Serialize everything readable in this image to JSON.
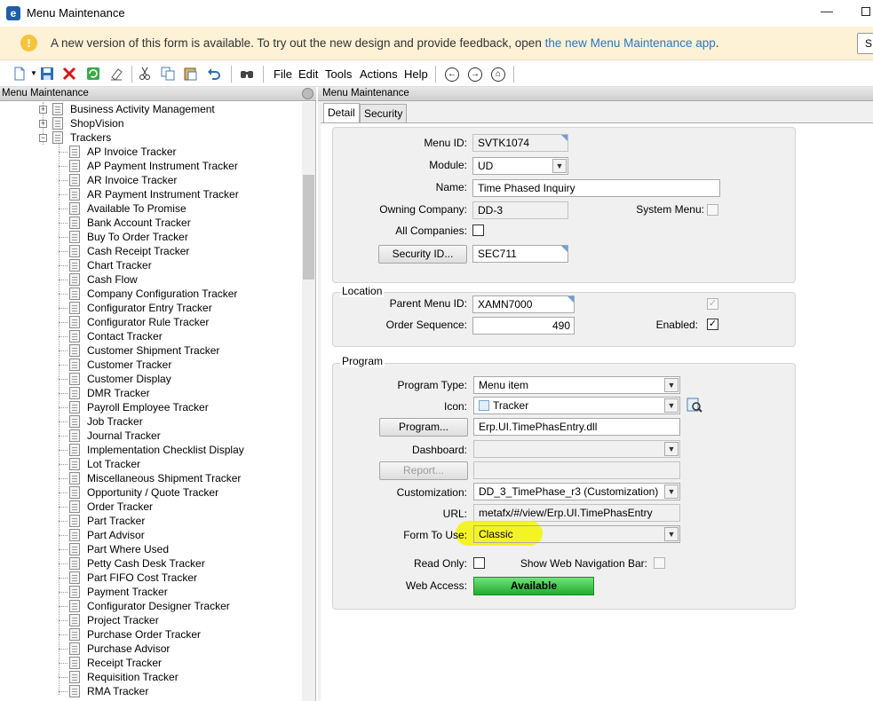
{
  "window": {
    "title": "Menu Maintenance",
    "logo": "e",
    "minimize": "—"
  },
  "banner": {
    "text": "A new version of this form is available. To try out the new design and provide feedback, open ",
    "link": "the new Menu Maintenance app",
    "suffix": ".",
    "button": "S"
  },
  "toolbar": {
    "icons": [
      "new-icon",
      "save-icon",
      "delete-icon",
      "refresh-icon",
      "clear-icon",
      "cut-icon",
      "copy-icon",
      "paste-icon",
      "undo-icon",
      "search-icon"
    ],
    "menus": [
      "File",
      "Edit",
      "Tools",
      "Actions",
      "Help"
    ],
    "nav_icons": [
      "back-icon",
      "forward-icon",
      "home-icon"
    ]
  },
  "left_pane": {
    "header": "Menu Maintenance",
    "parents": [
      {
        "label": "Business Activity Management",
        "expander": "+"
      },
      {
        "label": "ShopVision",
        "expander": "+"
      },
      {
        "label": "Trackers",
        "expander": "−"
      }
    ],
    "children": [
      "AP Invoice Tracker",
      "AP Payment Instrument Tracker",
      "AR Invoice Tracker",
      "AR Payment Instrument Tracker",
      "Available To Promise",
      "Bank Account Tracker",
      "Buy To Order Tracker",
      "Cash Receipt Tracker",
      "Chart Tracker",
      "Cash Flow",
      "Company Configuration Tracker",
      "Configurator Entry Tracker",
      "Configurator Rule Tracker",
      "Contact Tracker",
      "Customer Shipment Tracker",
      "Customer Tracker",
      "Customer Display",
      "DMR Tracker",
      "Payroll Employee Tracker",
      "Job Tracker",
      "Journal Tracker",
      "Implementation Checklist Display",
      "Lot Tracker",
      "Miscellaneous Shipment Tracker",
      "Opportunity / Quote Tracker",
      "Order Tracker",
      "Part Tracker",
      "Part Advisor",
      "Part Where Used",
      "Petty Cash Desk Tracker",
      "Part FIFO Cost Tracker",
      "Payment Tracker",
      "Configurator Designer Tracker",
      "Project Tracker",
      "Purchase Order Tracker",
      "Purchase Advisor",
      "Receipt Tracker",
      "Requisition Tracker",
      "RMA Tracker"
    ]
  },
  "right_pane": {
    "header": "Menu Maintenance",
    "tabs": [
      "Detail",
      "Security"
    ],
    "detail": {
      "menu_id_label": "Menu ID:",
      "menu_id": "SVTK1074",
      "module_label": "Module:",
      "module": "UD",
      "name_label": "Name:",
      "name": "Time Phased Inquiry",
      "owning_company_label": "Owning Company:",
      "owning_company": "DD-3",
      "system_menu_label": "System Menu:",
      "all_companies_label": "All Companies:",
      "security_id_button": "Security ID...",
      "security_id": "SEC711"
    },
    "location": {
      "title": "Location",
      "parent_menu_id_label": "Parent Menu ID:",
      "parent_menu_id": "XAMN7000",
      "order_sequence_label": "Order Sequence:",
      "order_sequence": "490",
      "enabled_label": "Enabled:",
      "check": "✓"
    },
    "program": {
      "title": "Program",
      "program_type_label": "Program Type:",
      "program_type": "Menu item",
      "icon_label": "Icon:",
      "icon": "Tracker",
      "program_button": "Program...",
      "program": "Erp.UI.TimePhasEntry.dll",
      "dashboard_label": "Dashboard:",
      "dashboard": "",
      "report_button": "Report...",
      "report": "",
      "customization_label": "Customization:",
      "customization": "DD_3_TimePhase_r3 (Customization)",
      "url_label": "URL:",
      "url": "metafx/#/view/Erp.UI.TimePhasEntry",
      "form_to_use_label": "Form To Use:",
      "form_to_use": "Classic",
      "read_only_label": "Read Only:",
      "show_web_nav_label": "Show Web Navigation Bar:",
      "web_access_label": "Web Access:",
      "web_access": "Available"
    }
  },
  "colors": {
    "banner_bg": "#fdf1d6",
    "link": "#2a79c2",
    "highlight": "#f5f500",
    "web_access": "#1fae2d",
    "corner_marker": "#6aa0d8"
  }
}
